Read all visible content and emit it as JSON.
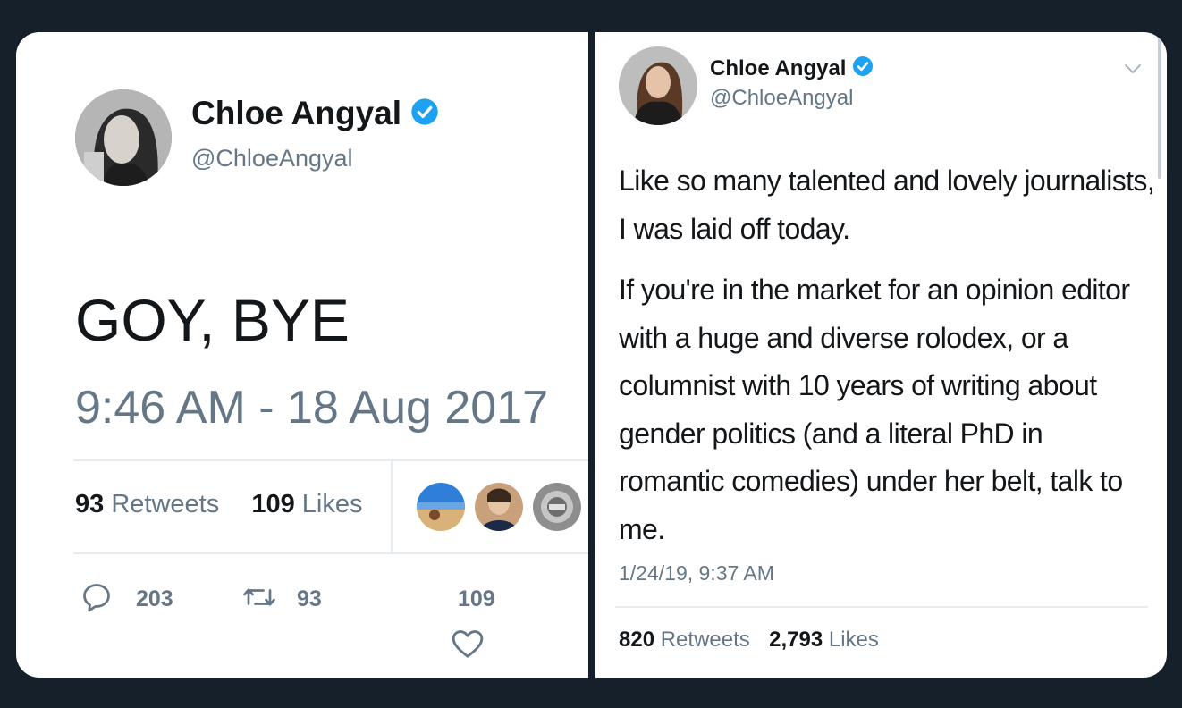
{
  "left_tweet": {
    "author": {
      "name": "Chloe Angyal",
      "handle": "@ChloeAngyal",
      "verified": true
    },
    "text": "GOY, BYE",
    "timestamp": "9:46 AM - 18 Aug 2017",
    "stats": {
      "retweets_count": "93",
      "retweets_label": "Retweets",
      "likes_count": "109",
      "likes_label": "Likes"
    },
    "actions": {
      "replies": "203",
      "retweets": "93",
      "likes": "109"
    }
  },
  "right_tweet": {
    "author": {
      "name": "Chloe Angyal",
      "handle": "@ChloeAngyal",
      "verified": true
    },
    "paragraph_1": "Like so many talented and lovely journalists, I was laid off today.",
    "paragraph_2": "If you're in the market for an opinion editor with a huge and diverse rolodex, or a columnist with 10 years of writing about gender politics (and a literal PhD in romantic comedies) under her belt, talk to me.",
    "timestamp": "1/24/19, 9:37 AM",
    "stats": {
      "retweets_count": "820",
      "retweets_label": "Retweets",
      "likes_count": "2,793",
      "likes_label": "Likes"
    }
  },
  "colors": {
    "background": "#15202b",
    "card": "#ffffff",
    "text": "#14171a",
    "secondary": "#657786",
    "verified": "#1da1f2"
  },
  "icons": [
    "verified-badge-icon",
    "reply-icon",
    "retweet-icon",
    "like-icon",
    "chevron-down-icon"
  ]
}
